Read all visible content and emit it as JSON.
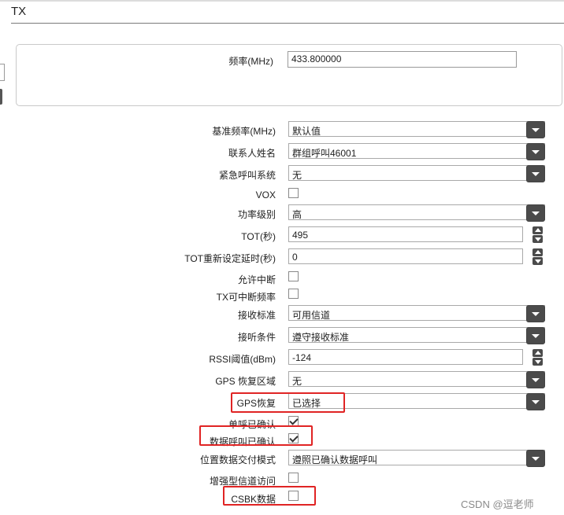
{
  "section": {
    "title": "TX"
  },
  "frequency": {
    "label": "频率(MHz)",
    "value": "433.800000"
  },
  "fields": {
    "ref_freq": {
      "label": "基准频率(MHz)",
      "value": "默认值"
    },
    "contact": {
      "label": "联系人姓名",
      "value": "群组呼叫46001"
    },
    "emergency": {
      "label": "紧急呼叫系统",
      "value": "无"
    },
    "vox": {
      "label": "VOX",
      "checked": false
    },
    "power": {
      "label": "功率级别",
      "value": "高"
    },
    "tot": {
      "label": "TOT(秒)",
      "value": "495"
    },
    "tot_rekey": {
      "label": "TOT重新设定延时(秒)",
      "value": "0"
    },
    "allow_interrupt": {
      "label": "允许中断",
      "checked": false
    },
    "tx_interrupt": {
      "label": "TX可中断频率",
      "checked": false
    },
    "rx_standard": {
      "label": "接收标准",
      "value": "可用信道"
    },
    "listen_cond": {
      "label": "接听条件",
      "value": "遵守接收标准"
    },
    "rssi": {
      "label": "RSSI阈值(dBm)",
      "value": "-124"
    },
    "gps_zone": {
      "label": "GPS 恢复区域",
      "value": "无"
    },
    "gps_revert": {
      "label": "GPS恢复",
      "value": "已选择"
    },
    "private_confirm": {
      "label": "单呼已确认",
      "checked": true
    },
    "data_confirm": {
      "label": "数据呼叫已确认",
      "checked": true
    },
    "loc_delivery": {
      "label": "位置数据交付模式",
      "value": "遵照已确认数据呼叫"
    },
    "enhanced_access": {
      "label": "增强型信道访问",
      "checked": false
    },
    "csbk_data": {
      "label": "CSBK数据",
      "checked": false
    }
  },
  "watermark": "CSDN @逗老师",
  "colors": {
    "highlight": "#e02424",
    "control_dark": "#4b4b4b"
  }
}
